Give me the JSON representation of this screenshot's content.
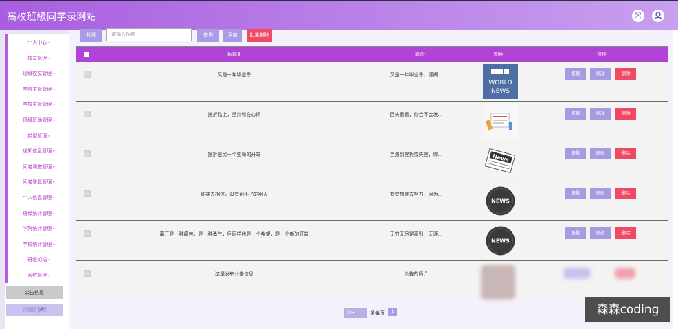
{
  "header": {
    "title": "高校班级同学录网站",
    "fullscreen_icon": "expand-icon",
    "user_icon": "user-icon"
  },
  "sidebar": {
    "items": [
      {
        "label": "个人中心"
      },
      {
        "label": "校友管理"
      },
      {
        "label": "班级校友管理"
      },
      {
        "label": "学院主管管理"
      },
      {
        "label": "学校主管管理"
      },
      {
        "label": "班级班助管理"
      },
      {
        "label": "类型管理"
      },
      {
        "label": "通知信息管理"
      },
      {
        "label": "问卷调查管理"
      },
      {
        "label": "问卷答复管理"
      },
      {
        "label": "个人信息管理"
      },
      {
        "label": "班级统计管理"
      },
      {
        "label": "学院统计管理"
      },
      {
        "label": "学校统计管理"
      },
      {
        "label": "班级论坛"
      },
      {
        "label": "系统管理"
      }
    ],
    "active": "公告信息",
    "faded": "轮播图管理"
  },
  "search": {
    "label": "标题",
    "placeholder": "请输入标题",
    "query_btn": "查询",
    "add_btn": "添加",
    "batch_delete_btn": "批量删除"
  },
  "table": {
    "headers": {
      "title": "标题",
      "summary": "简介",
      "image": "图片",
      "actions": "操作"
    },
    "actions": {
      "view": "查看",
      "edit": "修改",
      "delete": "删除"
    },
    "rows": [
      {
        "title": "又是一年毕业季",
        "summary": "又是一年毕业季，感概...",
        "image": "bbc-world-news"
      },
      {
        "title": "挫折路上，坚持常在心间",
        "summary": "回头看看，你会不会发...",
        "image": "newspaper-clipart"
      },
      {
        "title": "挫折是另一个生命的开端",
        "summary": "当遇到挫折或失败，你...",
        "image": "news-paper"
      },
      {
        "title": "你要去相信，没有到不了的明天",
        "summary": "有梦想就去努力，因为...",
        "image": "news-globe"
      },
      {
        "title": "离开是一种痛苦，是一种勇气，但同样也是一个希望，是一个新的开端",
        "summary": "无穷无尽是离别，天涯...",
        "image": "news-globe"
      },
      {
        "title": "这是发布公告信息",
        "summary": "公告的简介",
        "image": ""
      }
    ]
  },
  "pager": {
    "page_size": "10",
    "per_page_label": "条每页",
    "page": "1"
  },
  "watermark": "森森coding",
  "colors": {
    "header_start": "#a95ee0",
    "header_end": "#c7a0ef",
    "thead": "#b144d6",
    "delete": "#ef4a64",
    "button": "#a69be0"
  }
}
